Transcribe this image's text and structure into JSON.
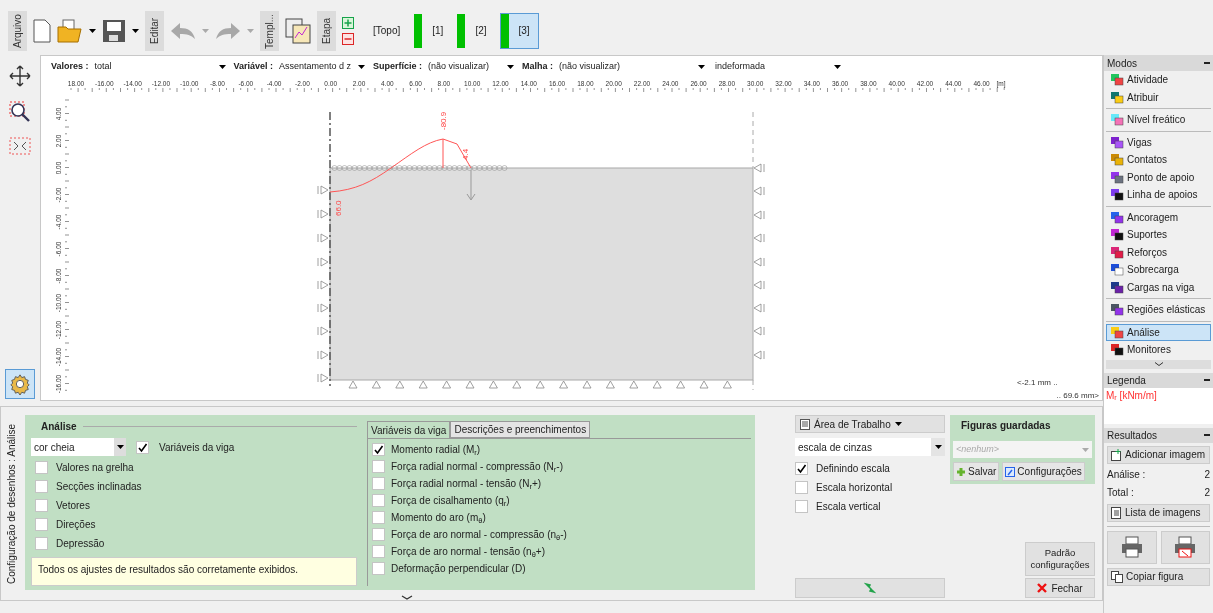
{
  "toolbar": {
    "file_label": "Arquivo",
    "edit_label": "Editar",
    "template_label": "Templ...",
    "stage_label": "Etapa",
    "undo_disabled": true,
    "redo_disabled": true
  },
  "stages": [
    {
      "label": "[Topo]",
      "analyzed": false,
      "selected": false
    },
    {
      "label": "[1]",
      "analyzed": true,
      "selected": false
    },
    {
      "label": "[2]",
      "analyzed": true,
      "selected": false
    },
    {
      "label": "[3]",
      "analyzed": true,
      "selected": true
    }
  ],
  "view_controls": [
    {
      "label": "Valores :",
      "value": "total"
    },
    {
      "label": "Variável :",
      "value": "Assentamento d z"
    },
    {
      "label": "Superfície :",
      "value": "(não visualizar)"
    },
    {
      "label": "Malha :",
      "value": "(não visualizar)"
    },
    {
      "value": "indeformada"
    }
  ],
  "ruler": {
    "x_labels": [
      "18.00",
      "-16.00",
      "-14.00",
      "-12.00",
      "-10.00",
      "-8.00",
      "-6.00",
      "-4.00",
      "-2.00",
      "0.00",
      "2.00",
      "4.00",
      "6.00",
      "8.00",
      "10.00",
      "12.00",
      "14.00",
      "16.00",
      "18.00",
      "20.00",
      "22.00",
      "24.00",
      "26.00",
      "28.00",
      "30.00",
      "32.00",
      "34.00",
      "36.00",
      "38.00",
      "40.00",
      "42.00",
      "44.00",
      "46.00"
    ],
    "unit": "[m]",
    "y_labels": [
      "4.00",
      "2.00",
      "0.00",
      "-2.00",
      "-4.00",
      "-6.00",
      "-8.00",
      "-10.00",
      "-12.00",
      "-14.00",
      "-16.00"
    ]
  },
  "diagram": {
    "values": [
      "-80.9",
      "4.4",
      "66.0"
    ]
  },
  "scale_readings": [
    "<-2.1 mm ..",
    ".. 69.6 mm>"
  ],
  "side_tools": {
    "settings_selected": true
  },
  "modes": {
    "title": "Modos",
    "groups": [
      [
        {
          "label": "Atividade",
          "selected": false
        },
        {
          "label": "Atribuir",
          "selected": false
        }
      ],
      [
        {
          "label": "Nível freático",
          "selected": false
        }
      ],
      [
        {
          "label": "Vigas",
          "selected": false
        },
        {
          "label": "Contatos",
          "selected": false
        },
        {
          "label": "Ponto de apoio",
          "selected": false
        },
        {
          "label": "Linha de apoios",
          "selected": false
        }
      ],
      [
        {
          "label": "Ancoragem",
          "selected": false
        },
        {
          "label": "Suportes",
          "selected": false
        },
        {
          "label": "Reforços",
          "selected": false
        },
        {
          "label": "Sobrecarga",
          "selected": false
        },
        {
          "label": "Cargas na viga",
          "selected": false
        }
      ],
      [
        {
          "label": "Regiões elásticas",
          "selected": false
        }
      ],
      [
        {
          "label": "Análise",
          "selected": true
        },
        {
          "label": "Monitores",
          "selected": false
        }
      ]
    ]
  },
  "legend": {
    "title": "Legenda",
    "entries": [
      "M$_{r}$ [kNm/m]"
    ]
  },
  "results": {
    "title": "Resultados",
    "add_button": "Adicionar imagem",
    "counts": [
      {
        "label": "Análise :",
        "value": "2"
      },
      {
        "label": "Total :",
        "value": "2"
      }
    ],
    "list_button": "Lista de imagens",
    "copy_button": "Copiar figura"
  },
  "settings_panel": {
    "side_label": "Configuração de desenhos : Análise",
    "analysis": {
      "title": "Análise",
      "fill_select": "cor cheia",
      "beam_vars": {
        "label": "Variáveis da viga",
        "checked": true
      },
      "options": [
        {
          "label": "Valores na grelha",
          "checked": false
        },
        {
          "label": "Secções inclinadas",
          "checked": false
        },
        {
          "label": "Vetores",
          "checked": false
        },
        {
          "label": "Direções",
          "checked": false
        },
        {
          "label": "Depressão",
          "checked": false
        }
      ],
      "note": "Todos os ajustes de resultados são corretamente exibidos."
    },
    "tabs": [
      {
        "label": "Variáveis da viga",
        "selected": true
      },
      {
        "label": "Descrições e preenchimentos",
        "selected": false
      }
    ],
    "variables": [
      {
        "label": "Momento radial (M$_{r}$)",
        "checked": true
      },
      {
        "label": "Força radial normal - compressão (N$_{r}$-)",
        "checked": false
      },
      {
        "label": "Força radial normal - tensão (N$_{r}$+)",
        "checked": false
      },
      {
        "label": "Força de cisalhamento (q$_{r}$)",
        "checked": false
      },
      {
        "label": "Momento do aro (m$_{θ}$)",
        "checked": false
      },
      {
        "label": "Força de aro normal - compressão (n$_{θ}$-)",
        "checked": false
      },
      {
        "label": "Força de aro normal - tensão (n$_{θ}$+)",
        "checked": false
      },
      {
        "label": "Deformação perpendicular (D)",
        "checked": false
      }
    ]
  },
  "workspace": {
    "menu": "Área de Trabalho",
    "color_select": "escala de cinzas",
    "options": [
      {
        "label": "Definindo escala",
        "checked": true
      },
      {
        "label": "Escala horizontal",
        "checked": false
      },
      {
        "label": "Escala vertical",
        "checked": false
      }
    ]
  },
  "saved_figures": {
    "title": "Figuras guardadas",
    "select_placeholder": "<nenhum>",
    "buttons": [
      "Salvar",
      "Configurações"
    ]
  },
  "default_button": "Padrão configurações",
  "close_button": "Fechar"
}
